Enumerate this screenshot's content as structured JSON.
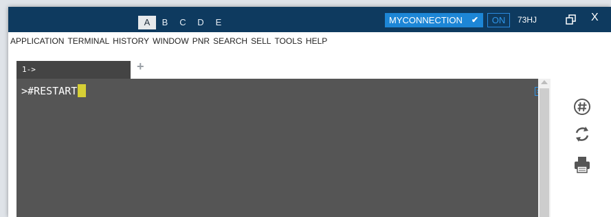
{
  "area_tabs": [
    {
      "label": "A",
      "active": true
    },
    {
      "label": "B",
      "active": false
    },
    {
      "label": "C",
      "active": false
    },
    {
      "label": "D",
      "active": false
    },
    {
      "label": "E",
      "active": false
    }
  ],
  "connection": {
    "label": "MYCONNECTION",
    "toggle": "ON"
  },
  "user_id": "73HJ",
  "window_controls": {
    "close": "X"
  },
  "menu": [
    "APPLICATION",
    "TERMINAL",
    "HISTORY",
    "WINDOW",
    "PNR",
    "SEARCH",
    "SELL",
    "TOOLS",
    "HELP"
  ],
  "terminal_tab": {
    "label": "1->",
    "add_label": "+"
  },
  "terminal": {
    "prompt": ">",
    "command": "#RESTART"
  },
  "colors": {
    "titlebar": "#0e3a5f",
    "connection_bg": "#1d86d6",
    "terminal_bg": "#555555",
    "tab_bg": "#444444",
    "cursor": "#d6cf35"
  },
  "icons": [
    "chevron-down-icon",
    "restore-window-icon",
    "close-icon",
    "add-tab-icon",
    "scroll-icon",
    "hash-icon",
    "refresh-icon",
    "print-icon"
  ]
}
